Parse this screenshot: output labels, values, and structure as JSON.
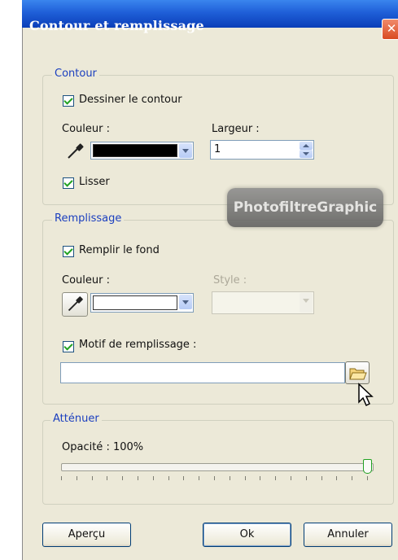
{
  "window": {
    "title": "Contour et remplissage",
    "close_glyph": "✕"
  },
  "contour": {
    "legend": "Contour",
    "draw_outline_label": "Dessiner le contour",
    "draw_outline_checked": true,
    "color_label": "Couleur :",
    "color_value": "#000000",
    "width_label": "Largeur :",
    "width_value": "1",
    "smooth_label": "Lisser",
    "smooth_checked": true
  },
  "fill": {
    "legend": "Remplissage",
    "fill_background_label": "Remplir le fond",
    "fill_background_checked": true,
    "color_label": "Couleur :",
    "color_value": "#ffffff",
    "style_label": "Style :",
    "style_value": "",
    "pattern_label": "Motif de remplissage :",
    "pattern_checked": true,
    "pattern_path": ""
  },
  "attenuate": {
    "legend": "Atténuer",
    "opacity_label": "Opacité : 100%",
    "opacity_value": 100
  },
  "buttons": {
    "preview": "Aperçu",
    "ok": "Ok",
    "cancel": "Annuler"
  },
  "watermark": "PhotofiltreGraphic",
  "icons": [
    "eyedropper-icon",
    "folder-open-icon",
    "mouse-cursor-icon"
  ]
}
